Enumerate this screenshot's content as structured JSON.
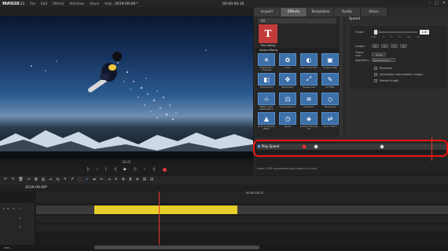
{
  "app": {
    "logo": "MAGIX",
    "menu": [
      "File",
      "Edit",
      "Effects",
      "Windows",
      "Share",
      "Help"
    ],
    "window_controls": [
      "–",
      "□",
      "✕"
    ]
  },
  "preview": {
    "timecode_left": "00:00:18:22",
    "project_name": "2019-09-09 *",
    "timecode_right": "00:00:40:16",
    "marker_label": "18:22",
    "transport": [
      "|‹",
      "‹",
      "|",
      "‹|",
      "▶",
      "|›",
      "›",
      "›|"
    ]
  },
  "panel": {
    "tabs": [
      "Import",
      "Effects",
      "Templates",
      "Audio",
      "Store"
    ],
    "active_tab": "Effects",
    "dropdown": "All",
    "title_tile_glyph": "T",
    "title_tile_label": "Title editing",
    "section_header": "Video effects",
    "effects": [
      {
        "label": "Brightness / Contrast",
        "icon": "sun-icon",
        "glyph": "☀"
      },
      {
        "label": "Color",
        "icon": "palette-icon",
        "glyph": "✿"
      },
      {
        "label": "Color correction",
        "icon": "color-correction-icon",
        "glyph": "◐"
      },
      {
        "label": "Lookup table",
        "icon": "lut-icon",
        "glyph": "▣"
      },
      {
        "label": "Chroma key",
        "icon": "chroma-key-icon",
        "glyph": "◧"
      },
      {
        "label": "Movement",
        "icon": "movement-icon",
        "glyph": "✥"
      },
      {
        "label": "Transformer",
        "icon": "transform-icon",
        "glyph": "⤢"
      },
      {
        "label": "Art filter",
        "icon": "art-filter-icon",
        "glyph": "✎"
      },
      {
        "label": "NEW! Video Stabilization",
        "icon": "stabilization-icon",
        "glyph": "⊹"
      },
      {
        "label": "Camera/zoom",
        "icon": "camera-zoom-icon",
        "glyph": "⊡"
      },
      {
        "label": "Distortion",
        "icon": "distortion-icon",
        "glyph": "≋"
      },
      {
        "label": "Sharpness",
        "icon": "sharpness-icon",
        "glyph": "◇"
      },
      {
        "label": "Good to be true Black",
        "icon": "black-icon",
        "glyph": "▲"
      },
      {
        "label": "Speed",
        "icon": "speed-icon",
        "glyph": "◷"
      },
      {
        "label": "proDAD Mercalli 2.0",
        "icon": "mercalli-icon",
        "glyph": "◈"
      },
      {
        "label": "Color match",
        "icon": "color-match-icon",
        "glyph": "⇄"
      }
    ],
    "speed": {
      "title": "Speed",
      "factor_label": "Factor:",
      "factor_value": "2.00",
      "factor_fraction": 0.02,
      "ticks": [
        "0.25",
        "1",
        "2",
        "5",
        "10",
        "25"
      ],
      "length_label": "Length:",
      "length_value": [
        "00",
        "01",
        "37",
        "05"
      ],
      "frame_label": "Frame rate:",
      "frame_value": "30.00",
      "algo_label": "Algorithm:",
      "algo_value": "Resampling (n...",
      "options": [
        "Reversed",
        "Interpolate intermediate images",
        "Marked length"
      ]
    }
  },
  "keyframes": {
    "track_label": "Play Speed",
    "hint": "video 1238 scenequestion/s speed in script"
  },
  "toolbar": {
    "tools": [
      "↶",
      "↷",
      "🗑",
      "✂",
      "⧉",
      "▤",
      "⇔",
      "⇆",
      "↰",
      "↱",
      "⬚",
      "↖",
      "⬌",
      "✂",
      "⇥",
      "✎",
      "✜",
      "⧗",
      "≡",
      "⊞",
      "⊟"
    ]
  },
  "timeline": {
    "project_tab": "2019-09-09*",
    "timecode": "00:00:18:22",
    "status": "89%"
  }
}
